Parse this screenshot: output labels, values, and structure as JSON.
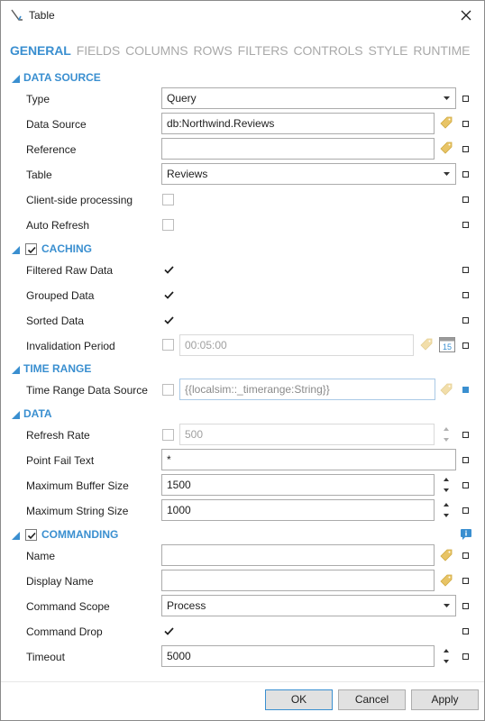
{
  "window": {
    "title": "Table"
  },
  "tabs": [
    "GENERAL",
    "FIELDS",
    "COLUMNS",
    "ROWS",
    "FILTERS",
    "CONTROLS",
    "STYLE",
    "RUNTIME"
  ],
  "sections": {
    "data_source": "DATA SOURCE",
    "caching": "CACHING",
    "time_range": "TIME RANGE",
    "data": "DATA",
    "commanding": "COMMANDING"
  },
  "fields": {
    "type": {
      "label": "Type",
      "value": "Query"
    },
    "data_source": {
      "label": "Data Source",
      "value": "db:Northwind.Reviews"
    },
    "reference": {
      "label": "Reference",
      "value": ""
    },
    "table": {
      "label": "Table",
      "value": "Reviews"
    },
    "client_side": {
      "label": "Client-side processing",
      "checked": false
    },
    "auto_refresh": {
      "label": "Auto Refresh",
      "checked": false
    },
    "caching_enabled": true,
    "filtered_raw": {
      "label": "Filtered Raw Data",
      "checked": true
    },
    "grouped": {
      "label": "Grouped Data",
      "checked": true
    },
    "sorted": {
      "label": "Sorted Data",
      "checked": true
    },
    "invalidation": {
      "label": "Invalidation Period",
      "checked": false,
      "value": "00:05:00"
    },
    "time_range_ds": {
      "label": "Time Range Data Source",
      "checked": false,
      "value": "{{localsim::_timerange:String}}"
    },
    "refresh_rate": {
      "label": "Refresh Rate",
      "checked": false,
      "value": "500"
    },
    "point_fail": {
      "label": "Point Fail Text",
      "value": "*"
    },
    "max_buffer": {
      "label": "Maximum Buffer Size",
      "value": "1500"
    },
    "max_string": {
      "label": "Maximum String Size",
      "value": "1000"
    },
    "commanding_enabled": true,
    "name": {
      "label": "Name",
      "value": ""
    },
    "display_name": {
      "label": "Display Name",
      "value": ""
    },
    "command_scope": {
      "label": "Command Scope",
      "value": "Process"
    },
    "command_drop": {
      "label": "Command Drop",
      "checked": true
    },
    "timeout": {
      "label": "Timeout",
      "value": "5000"
    }
  },
  "calendar_icon_text": "15",
  "buttons": {
    "ok": "OK",
    "cancel": "Cancel",
    "apply": "Apply"
  },
  "colors": {
    "accent": "#3a8fd0",
    "tag": "#e8c466"
  }
}
